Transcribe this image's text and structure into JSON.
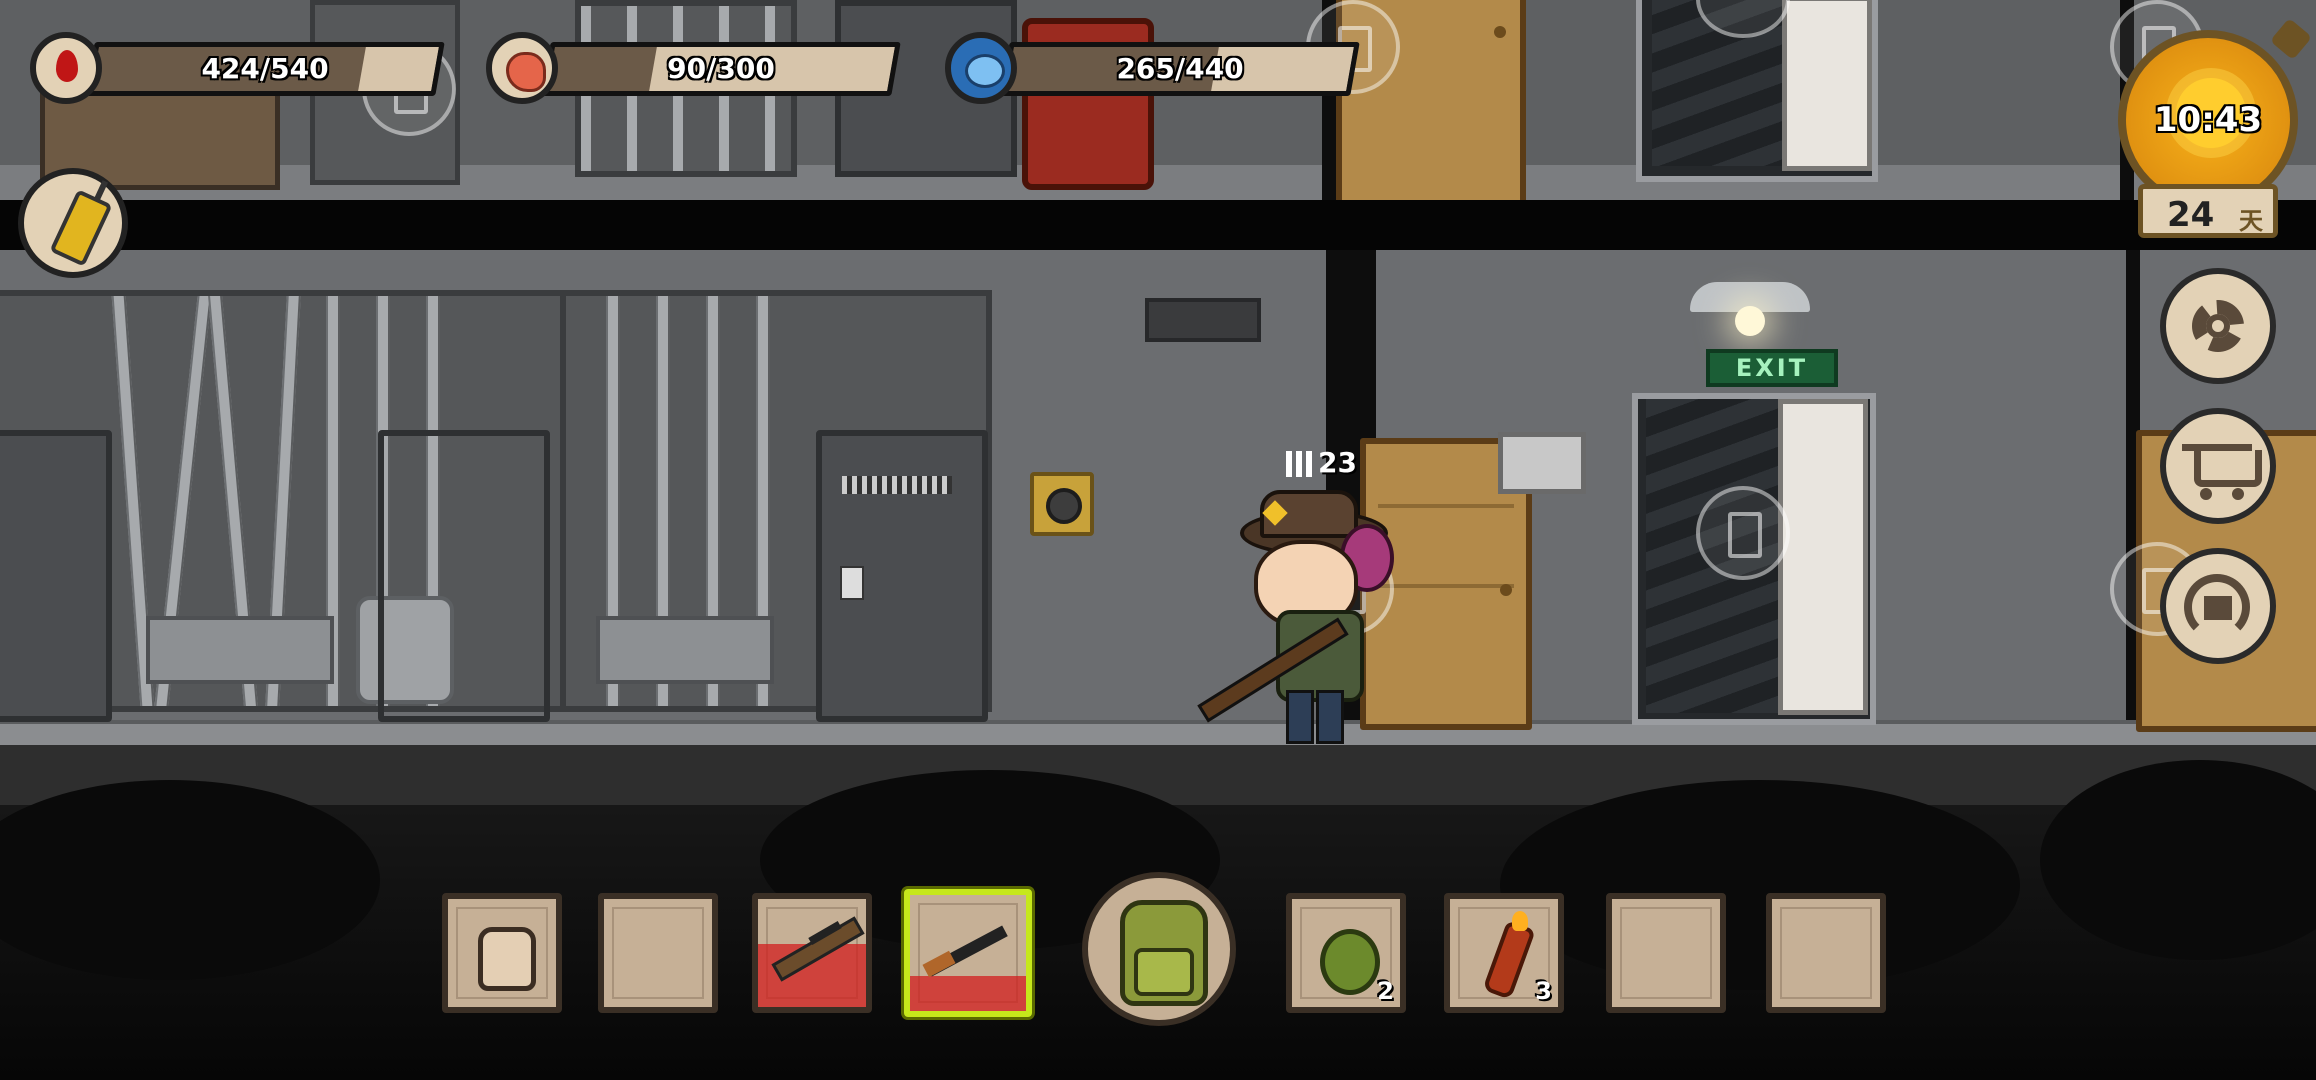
{
  "hud": {
    "health": {
      "label": "424/540",
      "value": 424,
      "max": 540,
      "icon": "blood-drop-icon",
      "color": "#c01616"
    },
    "hunger": {
      "label": "90/300",
      "value": 90,
      "max": 300,
      "icon": "stomach-icon",
      "color": "#e5654a"
    },
    "sanity": {
      "label": "265/440",
      "value": 265,
      "max": 440,
      "icon": "brain-icon",
      "color": "#2a6db5"
    },
    "radio_icon": "walkie-talkie-icon",
    "clock": {
      "time": "10:43",
      "icon": "sun-icon"
    },
    "day": {
      "number": "24",
      "unit": "天"
    },
    "side_buttons": [
      "settings-gear-icon",
      "shop-cart-icon",
      "return-home-icon"
    ]
  },
  "scene": {
    "exit_sign": "EXIT",
    "player": {
      "ammo": "23",
      "icon": "ammo-bullets-icon"
    }
  },
  "hotbar": {
    "slots": [
      {
        "item": "fist-icon",
        "count": "",
        "selected": false
      },
      {
        "item": "",
        "count": "",
        "selected": false
      },
      {
        "item": "sniper-rifle-icon",
        "count": "",
        "selected": false,
        "durability_low": true
      },
      {
        "item": "assault-rifle-icon",
        "count": "",
        "selected": true,
        "durability_low": true
      },
      {
        "item": "grenade-icon",
        "count": "2",
        "selected": false
      },
      {
        "item": "molotov-icon",
        "count": "3",
        "selected": false
      },
      {
        "item": "",
        "count": "",
        "selected": false
      },
      {
        "item": "",
        "count": "",
        "selected": false
      }
    ],
    "backpack_icon": "backpack-icon",
    "selected_color": "#c6e81b"
  }
}
